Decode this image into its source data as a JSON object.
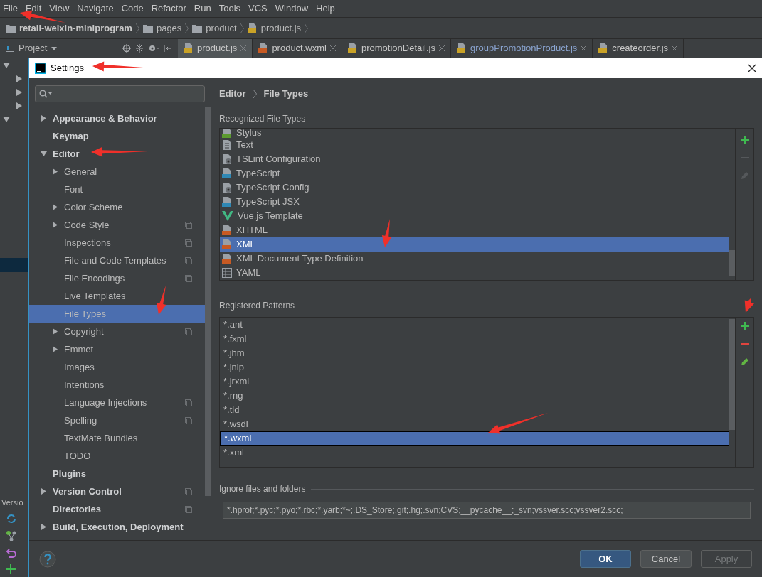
{
  "menu": [
    "File",
    "Edit",
    "View",
    "Navigate",
    "Code",
    "Refactor",
    "Run",
    "Tools",
    "VCS",
    "Window",
    "Help"
  ],
  "breadcrumb": [
    {
      "label": "retail-weixin-miniprogram",
      "kind": "folder",
      "bold": true
    },
    {
      "label": "pages",
      "kind": "folder",
      "bold": false
    },
    {
      "label": "product",
      "kind": "folder",
      "bold": false
    },
    {
      "label": "product.js",
      "kind": "js",
      "bold": false
    }
  ],
  "project_tool": {
    "label": "Project"
  },
  "tabs": [
    {
      "label": "product.js",
      "kind": "js",
      "selected": true
    },
    {
      "label": "product.wxml",
      "kind": "xml",
      "selected": false
    },
    {
      "label": "promotionDetail.js",
      "kind": "js",
      "selected": false
    },
    {
      "label": "groupPromotionProduct.js",
      "kind": "js",
      "selected": false
    },
    {
      "label": "createorder.js",
      "kind": "js",
      "selected": false
    }
  ],
  "side_tool": {
    "label": "Versio"
  },
  "dialog": {
    "title": "Settings",
    "tree": [
      {
        "label": "Appearance & Behavior",
        "expandable": true,
        "expanded": false,
        "selected": false,
        "project_scoped": false
      },
      {
        "label": "Keymap",
        "expandable": false,
        "expanded": false,
        "selected": false,
        "project_scoped": false
      },
      {
        "label": "Editor",
        "expandable": true,
        "expanded": true,
        "selected": false,
        "project_scoped": false,
        "children": [
          {
            "label": "General",
            "expandable": true,
            "expanded": false,
            "selected": false,
            "project_scoped": false
          },
          {
            "label": "Font",
            "expandable": false,
            "expanded": false,
            "selected": false,
            "project_scoped": false
          },
          {
            "label": "Color Scheme",
            "expandable": true,
            "expanded": false,
            "selected": false,
            "project_scoped": false
          },
          {
            "label": "Code Style",
            "expandable": true,
            "expanded": false,
            "selected": false,
            "project_scoped": true
          },
          {
            "label": "Inspections",
            "expandable": false,
            "expanded": false,
            "selected": false,
            "project_scoped": true
          },
          {
            "label": "File and Code Templates",
            "expandable": false,
            "expanded": false,
            "selected": false,
            "project_scoped": true
          },
          {
            "label": "File Encodings",
            "expandable": false,
            "expanded": false,
            "selected": false,
            "project_scoped": true
          },
          {
            "label": "Live Templates",
            "expandable": false,
            "expanded": false,
            "selected": false,
            "project_scoped": false
          },
          {
            "label": "File Types",
            "expandable": false,
            "expanded": false,
            "selected": true,
            "project_scoped": false
          },
          {
            "label": "Copyright",
            "expandable": true,
            "expanded": false,
            "selected": false,
            "project_scoped": true
          },
          {
            "label": "Emmet",
            "expandable": true,
            "expanded": false,
            "selected": false,
            "project_scoped": false
          },
          {
            "label": "Images",
            "expandable": false,
            "expanded": false,
            "selected": false,
            "project_scoped": false
          },
          {
            "label": "Intentions",
            "expandable": false,
            "expanded": false,
            "selected": false,
            "project_scoped": false
          },
          {
            "label": "Language Injections",
            "expandable": false,
            "expanded": false,
            "selected": false,
            "project_scoped": true
          },
          {
            "label": "Spelling",
            "expandable": false,
            "expanded": false,
            "selected": false,
            "project_scoped": true
          },
          {
            "label": "TextMate Bundles",
            "expandable": false,
            "expanded": false,
            "selected": false,
            "project_scoped": false
          },
          {
            "label": "TODO",
            "expandable": false,
            "expanded": false,
            "selected": false,
            "project_scoped": false
          }
        ]
      },
      {
        "label": "Plugins",
        "expandable": false,
        "expanded": false,
        "selected": false,
        "project_scoped": false
      },
      {
        "label": "Version Control",
        "expandable": true,
        "expanded": false,
        "selected": false,
        "project_scoped": true
      },
      {
        "label": "Directories",
        "expandable": false,
        "expanded": false,
        "selected": false,
        "project_scoped": true
      },
      {
        "label": "Build, Execution, Deployment",
        "expandable": true,
        "expanded": false,
        "selected": false,
        "project_scoped": false
      }
    ],
    "page_path": [
      "Editor",
      "File Types"
    ],
    "recognized": {
      "title": "Recognized File Types",
      "items": [
        {
          "label": "Stylus",
          "kind": "stylus",
          "selected": false
        },
        {
          "label": "Text",
          "kind": "text",
          "selected": false
        },
        {
          "label": "TSLint Configuration",
          "kind": "config",
          "selected": false
        },
        {
          "label": "TypeScript",
          "kind": "ts",
          "selected": false
        },
        {
          "label": "TypeScript Config",
          "kind": "config",
          "selected": false
        },
        {
          "label": "TypeScript JSX",
          "kind": "tsx",
          "selected": false
        },
        {
          "label": "Vue.js Template",
          "kind": "vue",
          "selected": false
        },
        {
          "label": "XHTML",
          "kind": "xhtml",
          "selected": false
        },
        {
          "label": "XML",
          "kind": "xml",
          "selected": true
        },
        {
          "label": "XML Document Type Definition",
          "kind": "dtd",
          "selected": false
        },
        {
          "label": "YAML",
          "kind": "yaml",
          "selected": false
        }
      ],
      "toolbar": [
        {
          "kind": "add",
          "disabled": false
        },
        {
          "kind": "remove",
          "disabled": true
        },
        {
          "kind": "edit",
          "disabled": true
        }
      ]
    },
    "patterns": {
      "title": "Registered Patterns",
      "items": [
        {
          "label": "*.ant",
          "selected": false
        },
        {
          "label": "*.fxml",
          "selected": false
        },
        {
          "label": "*.jhm",
          "selected": false
        },
        {
          "label": "*.jnlp",
          "selected": false
        },
        {
          "label": "*.jrxml",
          "selected": false
        },
        {
          "label": "*.rng",
          "selected": false
        },
        {
          "label": "*.tld",
          "selected": false
        },
        {
          "label": "*.wsdl",
          "selected": false
        },
        {
          "label": "*.wxml",
          "selected": true
        },
        {
          "label": "*.xml",
          "selected": false
        }
      ],
      "toolbar": [
        {
          "kind": "add",
          "disabled": false
        },
        {
          "kind": "remove",
          "disabled": false
        },
        {
          "kind": "edit",
          "disabled": false
        }
      ]
    },
    "ignore": {
      "title": "Ignore files and folders",
      "value": "*.hprof;*.pyc;*.pyo;*.rbc;*.yarb;*~;.DS_Store;.git;.hg;.svn;CVS;__pycache__;_svn;vssver.scc;vssver2.scc;"
    },
    "buttons": [
      {
        "label": "OK",
        "default": true,
        "disabled": false
      },
      {
        "label": "Cancel",
        "default": false,
        "disabled": false
      },
      {
        "label": "Apply",
        "default": false,
        "disabled": true
      }
    ]
  }
}
